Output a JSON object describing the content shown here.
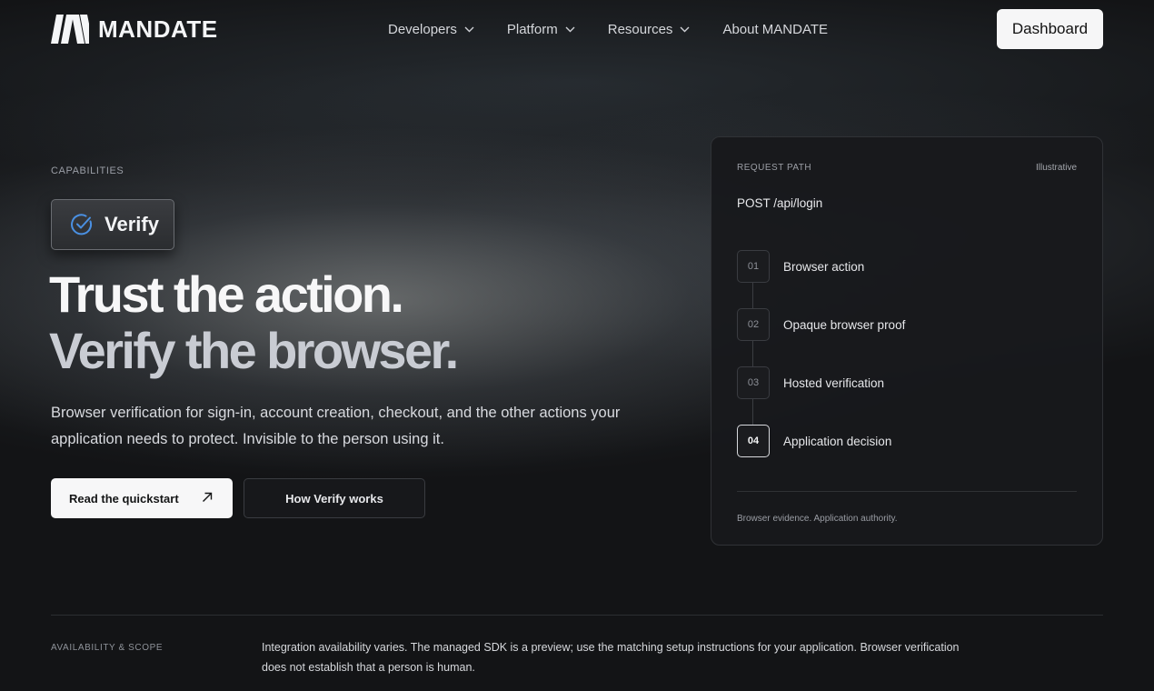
{
  "brand": {
    "name": "MANDATE"
  },
  "nav": {
    "items": [
      {
        "label": "Developers",
        "has_dropdown": true
      },
      {
        "label": "Platform",
        "has_dropdown": true
      },
      {
        "label": "Resources",
        "has_dropdown": true
      },
      {
        "label": "About MANDATE",
        "has_dropdown": false
      }
    ],
    "dashboard_label": "Dashboard"
  },
  "hero": {
    "eyebrow": "CAPABILITIES",
    "chip": {
      "label": "Verify",
      "icon": "check-circle-icon",
      "icon_color": "#4a90e2"
    },
    "headline_line1": "Trust the action.",
    "headline_line2": "Verify the browser.",
    "lead": "Browser verification for sign-in, account creation, checkout, and the other actions your application needs to protect. Invisible to the person using it.",
    "primary_cta": "Read the quickstart",
    "secondary_cta": "How Verify works"
  },
  "panel": {
    "label": "REQUEST PATH",
    "tag": "Illustrative",
    "route": "POST /api/login",
    "steps": [
      {
        "num": "01",
        "label": "Browser action"
      },
      {
        "num": "02",
        "label": "Opaque browser proof"
      },
      {
        "num": "03",
        "label": "Hosted verification"
      },
      {
        "num": "04",
        "label": "Application decision",
        "active": true
      }
    ],
    "footer": "Browser evidence. Application authority."
  },
  "availability": {
    "label": "AVAILABILITY & SCOPE",
    "text": "Integration availability varies. The managed SDK is a preview; use the matching setup instructions for your application. Browser verification does not establish that a person is human."
  }
}
